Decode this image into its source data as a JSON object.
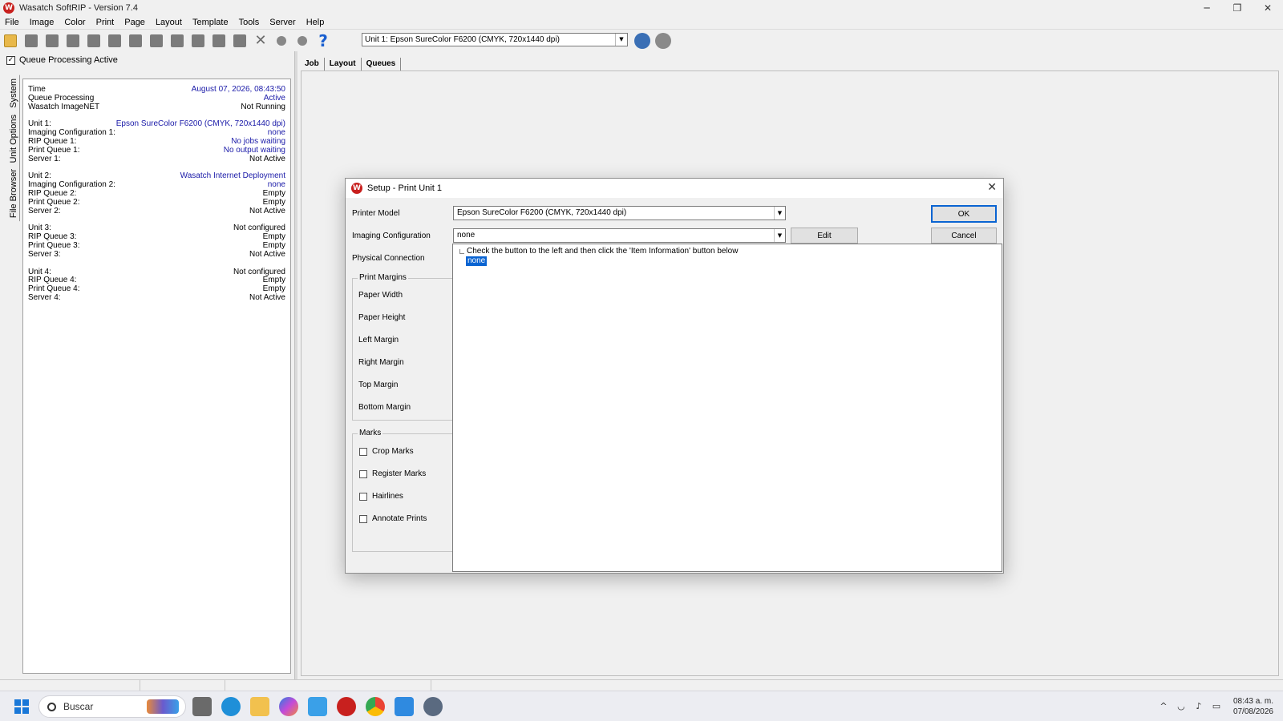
{
  "window": {
    "title": "Wasatch SoftRIP - Version 7.4",
    "minimize": "─",
    "restore": "❐",
    "close": "✕"
  },
  "menu": [
    "File",
    "Image",
    "Color",
    "Print",
    "Page",
    "Layout",
    "Template",
    "Tools",
    "Server",
    "Help"
  ],
  "toolbar": {
    "unit_select_value": "Unit 1: Epson  SureColor F6200  (CMYK, 720x1440 dpi)",
    "help_glyph": "?",
    "delete_glyph": "✕"
  },
  "left_panel": {
    "queue_processing_label": "Queue Processing Active",
    "queue_processing_checked": "✓",
    "vertical_tabs": [
      "System",
      "Unit Options",
      "File Browser"
    ],
    "groups": [
      [
        {
          "label": "Time",
          "value": "August 07, 2026,  08:43:50",
          "blue": true
        },
        {
          "label": "Queue Processing",
          "value": "Active",
          "blue": true
        },
        {
          "label": "Wasatch ImageNET",
          "value": "Not Running",
          "blue": false
        }
      ],
      [
        {
          "label": "Unit 1:",
          "value": "Epson  SureColor F6200  (CMYK, 720x1440 dpi)",
          "blue": true
        },
        {
          "label": "Imaging Configuration 1:",
          "value": "none",
          "blue": true
        },
        {
          "label": "RIP Queue 1:",
          "value": "No jobs waiting",
          "blue": true
        },
        {
          "label": "Print Queue 1:",
          "value": "No output waiting",
          "blue": true
        },
        {
          "label": "Server 1:",
          "value": "Not Active",
          "blue": false
        }
      ],
      [
        {
          "label": "Unit 2:",
          "value": "Wasatch  Internet  Deployment",
          "blue": true
        },
        {
          "label": "Imaging Configuration 2:",
          "value": "none",
          "blue": true
        },
        {
          "label": "RIP Queue 2:",
          "value": "Empty",
          "blue": false
        },
        {
          "label": "Print Queue 2:",
          "value": "Empty",
          "blue": false
        },
        {
          "label": "Server 2:",
          "value": "Not Active",
          "blue": false
        }
      ],
      [
        {
          "label": "Unit 3:",
          "value": "Not configured",
          "blue": false
        },
        {
          "label": "RIP Queue 3:",
          "value": "Empty",
          "blue": false
        },
        {
          "label": "Print Queue 3:",
          "value": "Empty",
          "blue": false
        },
        {
          "label": "Server 3:",
          "value": "Not Active",
          "blue": false
        }
      ],
      [
        {
          "label": "Unit 4:",
          "value": "Not configured",
          "blue": false
        },
        {
          "label": "RIP Queue 4:",
          "value": "Empty",
          "blue": false
        },
        {
          "label": "Print Queue 4:",
          "value": "Empty",
          "blue": false
        },
        {
          "label": "Server 4:",
          "value": "Not Active",
          "blue": false
        }
      ]
    ]
  },
  "tabs": [
    "Job",
    "Layout",
    "Queues"
  ],
  "dialog": {
    "title": "Setup - Print Unit 1",
    "close_glyph": "✕",
    "printer_model_label": "Printer Model",
    "printer_model_value": "Epson  SureColor F6200  (CMYK, 720x1440 dpi)",
    "imaging_config_label": "Imaging Configuration",
    "imaging_config_value": "none",
    "physical_connection_label": "Physical Connection",
    "edit_label": "Edit",
    "ok_label": "OK",
    "cancel_label": "Cancel",
    "print_margins_title": "Print Margins",
    "margins": [
      "Paper Width",
      "Paper Height",
      "Left Margin",
      "Right Margin",
      "Top Margin",
      "Bottom Margin"
    ],
    "marks_title": "Marks",
    "marks": [
      "Crop Marks",
      "Register Marks",
      "Hairlines",
      "Annotate Prints"
    ],
    "dropdown_hint": "Check the button to the left and then click the 'Item Information' button below",
    "dropdown_selected": "none",
    "dropdown_arrow": "▼"
  },
  "taskbar": {
    "search_placeholder": "Buscar",
    "time": "08:43 a. m.",
    "date": "07/08/2026",
    "tray_chevron": "^"
  },
  "colors": {
    "accent_blue": "#0a64d2",
    "status_blue": "#1a1aa8",
    "logo_red": "#c8201e"
  }
}
